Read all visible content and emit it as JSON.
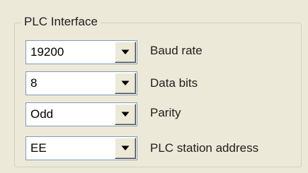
{
  "group": {
    "title": "PLC Interface"
  },
  "fields": [
    {
      "value": "19200",
      "label": "Baud rate",
      "icon": "chevron-down-icon"
    },
    {
      "value": "8",
      "label": "Data bits",
      "icon": "chevron-down-icon"
    },
    {
      "value": "Odd",
      "label": "Parity",
      "icon": "chevron-down-icon"
    },
    {
      "value": "EE",
      "label": "PLC station address",
      "icon": "chevron-down-icon"
    }
  ]
}
